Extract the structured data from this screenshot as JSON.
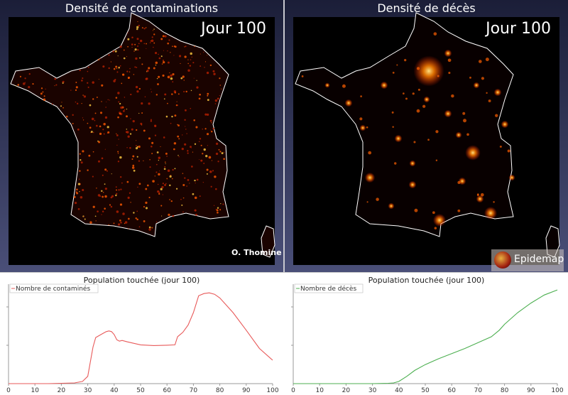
{
  "maps": {
    "left": {
      "title": "Densité de contaminations",
      "day": "Jour 100",
      "author": "O. Thomine"
    },
    "right": {
      "title": "Densité de décès",
      "day": "Jour 100",
      "logo": "Epidemap"
    }
  },
  "colors": {
    "contamination_line": "#e85a5a",
    "deaths_line": "#4caf50",
    "map_glow": "#ff8a00",
    "border": "#ffffff"
  },
  "chart_data": [
    {
      "type": "line",
      "title": "Population touchée (jour 100)",
      "xlabel": "",
      "ylabel": "",
      "xlim": [
        0,
        100
      ],
      "xticks": [
        0,
        10,
        20,
        30,
        40,
        50,
        60,
        70,
        80,
        90,
        100
      ],
      "grid": false,
      "legend": "top-left",
      "series": [
        {
          "name": "Nombre de contaminés",
          "x": [
            0,
            15,
            20,
            25,
            28,
            30,
            32,
            33,
            35,
            37,
            38,
            39,
            40,
            41,
            42,
            43,
            45,
            50,
            55,
            60,
            63,
            64,
            66,
            68,
            70,
            72,
            74,
            76,
            78,
            80,
            85,
            90,
            95,
            100
          ],
          "y": [
            0,
            0,
            0.5,
            1,
            3,
            10,
            50,
            63,
            67,
            71,
            72,
            71,
            67,
            60,
            58,
            59,
            57,
            53,
            52,
            52.5,
            53,
            64,
            70,
            80,
            97,
            120,
            123,
            124,
            122,
            117,
            97,
            73,
            48,
            32
          ]
        }
      ]
    },
    {
      "type": "line",
      "title": "Population touchée (jour 100)",
      "xlabel": "",
      "ylabel": "",
      "xlim": [
        0,
        100
      ],
      "xticks": [
        0,
        10,
        20,
        30,
        40,
        50,
        60,
        70,
        80,
        90,
        100
      ],
      "grid": false,
      "legend": "top-left",
      "series": [
        {
          "name": "Nombre de décès",
          "x": [
            0,
            30,
            36,
            38,
            40,
            43,
            46,
            50,
            55,
            60,
            65,
            70,
            75,
            78,
            80,
            85,
            90,
            95,
            100
          ],
          "y": [
            0,
            0,
            0.5,
            1,
            3,
            10,
            18,
            26,
            34,
            41,
            48,
            56,
            64,
            73,
            81,
            97,
            110,
            121,
            128
          ]
        }
      ]
    }
  ]
}
